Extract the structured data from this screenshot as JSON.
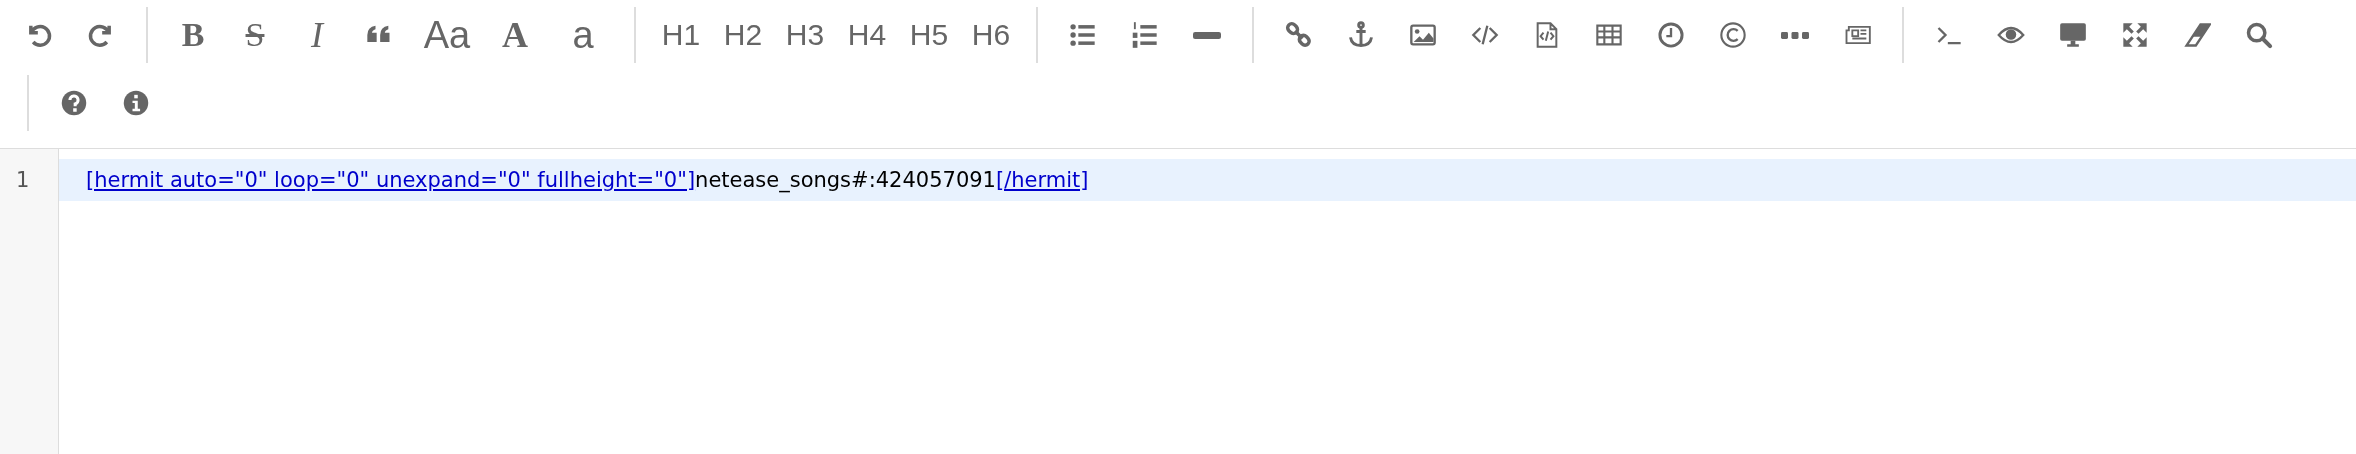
{
  "toolbar": {
    "text_buttons": [
      "B",
      "S",
      "I",
      "Aa",
      "A",
      "a",
      "H1",
      "H2",
      "H3",
      "H4",
      "H5",
      "H6"
    ]
  },
  "editor": {
    "lines": [
      {
        "number": "1",
        "active": true,
        "segments": [
          {
            "text": "[hermit auto=\"0\" loop=\"0\" unexpand=\"0\" fullheight=\"0\"]",
            "kind": "tag"
          },
          {
            "text": "netease_songs#:424057091",
            "kind": "plain"
          },
          {
            "text": "[/hermit]",
            "kind": "tag"
          }
        ]
      }
    ]
  }
}
